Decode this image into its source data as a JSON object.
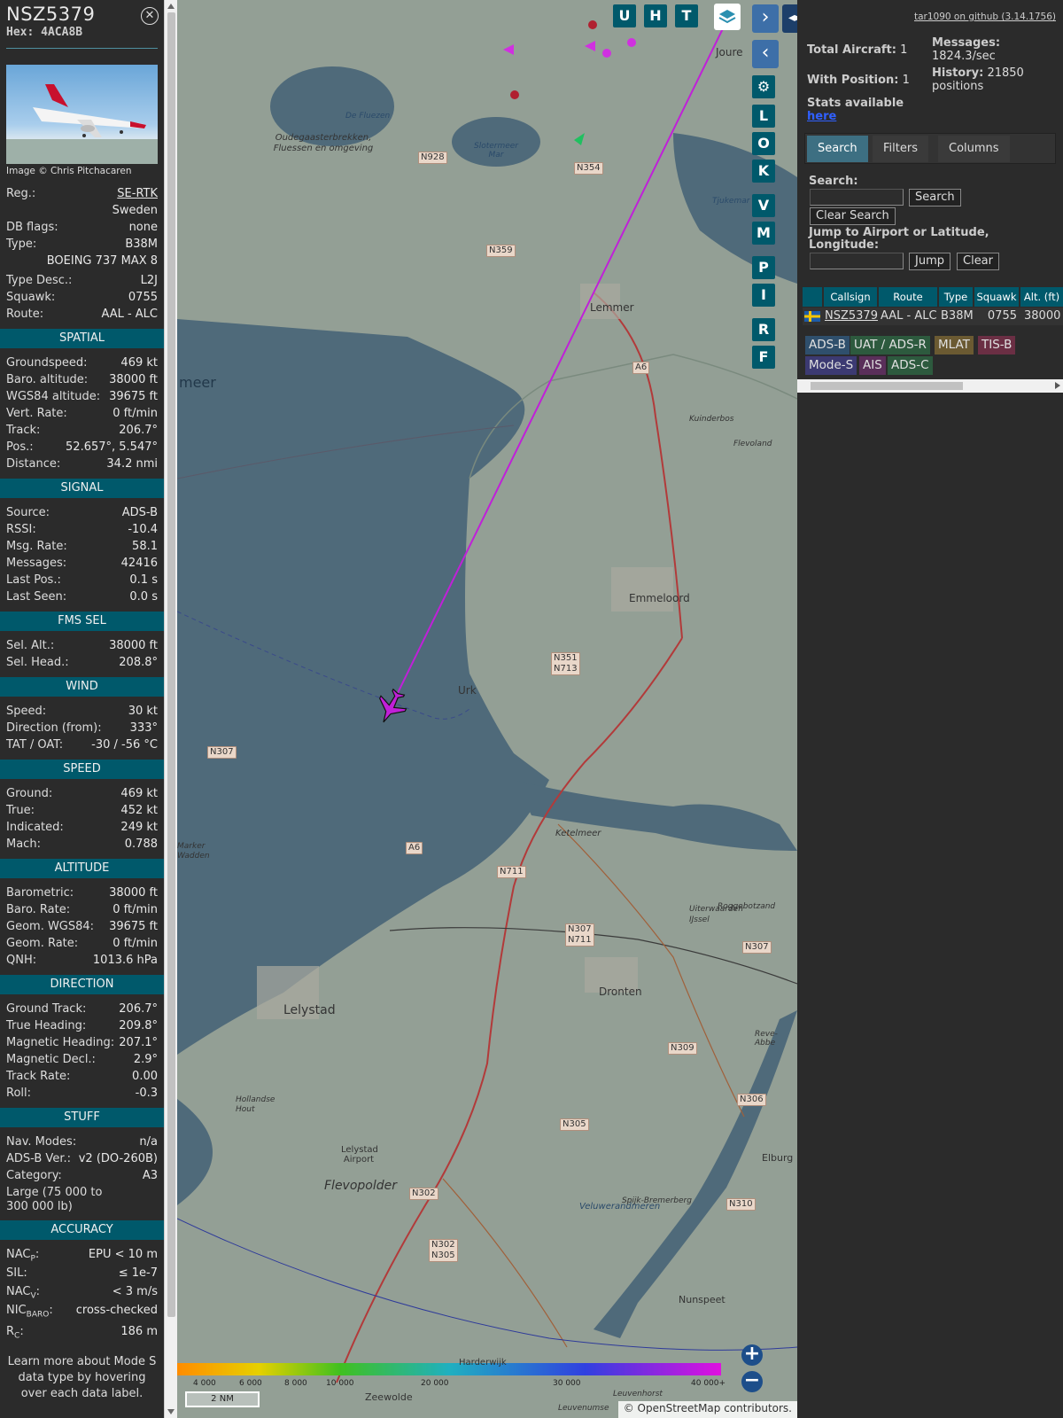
{
  "aircraft": {
    "callsign": "NSZ5379",
    "hex_label": "Hex: 4ACA8B",
    "image_credit": "Image © Chris Pitchacaren",
    "reg_label": "Reg.:",
    "reg": "SE-RTK",
    "country": "Sweden",
    "dbflags_label": "DB flags:",
    "dbflags": "none",
    "type_label": "Type:",
    "type": "B38M",
    "type_full": "BOEING 737 MAX 8",
    "typedesc_label": "Type Desc.:",
    "typedesc": "L2J",
    "squawk_label": "Squawk:",
    "squawk": "0755",
    "route_label": "Route:",
    "route": "AAL - ALC"
  },
  "sections": {
    "spatial": "SPATIAL",
    "signal": "SIGNAL",
    "fms": "FMS SEL",
    "wind": "WIND",
    "speed": "SPEED",
    "altitude": "ALTITUDE",
    "direction": "DIRECTION",
    "stuff": "STUFF",
    "accuracy": "ACCURACY"
  },
  "spatial": [
    {
      "label": "Groundspeed:",
      "value": "469 kt"
    },
    {
      "label": "Baro. altitude:",
      "value": "38000 ft"
    },
    {
      "label": "WGS84 altitude:",
      "value": "39675 ft"
    },
    {
      "label": "Vert. Rate:",
      "value": "0 ft/min"
    },
    {
      "label": "Track:",
      "value": "206.7°"
    },
    {
      "label": "Pos.:",
      "value": "52.657°, 5.547°"
    },
    {
      "label": "Distance:",
      "value": "34.2 nmi"
    }
  ],
  "signal": [
    {
      "label": "Source:",
      "value": "ADS-B"
    },
    {
      "label": "RSSI:",
      "value": "-10.4"
    },
    {
      "label": "Msg. Rate:",
      "value": "58.1"
    },
    {
      "label": "Messages:",
      "value": "42416"
    },
    {
      "label": "Last Pos.:",
      "value": "0.1 s"
    },
    {
      "label": "Last Seen:",
      "value": "0.0 s"
    }
  ],
  "fms": [
    {
      "label": "Sel. Alt.:",
      "value": "38000 ft"
    },
    {
      "label": "Sel. Head.:",
      "value": "208.8°"
    }
  ],
  "wind": [
    {
      "label": "Speed:",
      "value": "30 kt"
    },
    {
      "label": "Direction (from):",
      "value": "333°"
    },
    {
      "label": "TAT / OAT:",
      "value": "-30 / -56 °C"
    }
  ],
  "speed": [
    {
      "label": "Ground:",
      "value": "469 kt"
    },
    {
      "label": "True:",
      "value": "452 kt"
    },
    {
      "label": "Indicated:",
      "value": "249 kt"
    },
    {
      "label": "Mach:",
      "value": "0.788"
    }
  ],
  "altitude": [
    {
      "label": "Barometric:",
      "value": "38000 ft"
    },
    {
      "label": "Baro. Rate:",
      "value": "0 ft/min"
    },
    {
      "label": "Geom. WGS84:",
      "value": "39675 ft"
    },
    {
      "label": "Geom. Rate:",
      "value": "0 ft/min"
    },
    {
      "label": "QNH:",
      "value": "1013.6 hPa"
    }
  ],
  "direction": [
    {
      "label": "Ground Track:",
      "value": "206.7°"
    },
    {
      "label": "True Heading:",
      "value": "209.8°"
    },
    {
      "label": "Magnetic Heading:",
      "value": "207.1°"
    },
    {
      "label": "Magnetic Decl.:",
      "value": "2.9°"
    },
    {
      "label": "Track Rate:",
      "value": "0.00"
    },
    {
      "label": "Roll:",
      "value": "-0.3"
    }
  ],
  "stuff": {
    "navmodes_label": "Nav. Modes:",
    "navmodes": "n/a",
    "adsbver_label": "ADS-B Ver.:",
    "adsbver": "v2 (DO-260B)",
    "category_label": "Category:",
    "category": "A3",
    "category_desc": "Large (75 000 to 300 000 lb)"
  },
  "accuracy": {
    "nacp_label": "NAC",
    "nacp_sub": "P",
    "nacp": "EPU < 10 m",
    "sil_label": "SIL:",
    "sil": "≤ 1e-7",
    "nacv_label": "NAC",
    "nacv_sub": "V",
    "nacv": "< 3 m/s",
    "nicbaro_label": "NIC",
    "nicbaro_sub": "BARO",
    "nicbaro": "cross-checked",
    "rc_label": "R",
    "rc_sub": "C",
    "rc": "186 m"
  },
  "footer_note": "Learn more about Mode S data type by hovering over each data label.",
  "map": {
    "buttons": [
      "U",
      "H",
      "T"
    ],
    "side_buttons": [
      "L",
      "O",
      "K",
      "V",
      "M",
      "P",
      "I",
      "R",
      "F"
    ],
    "scale": "2 NM",
    "attribution": "© OpenStreetMap contributors.",
    "legend_ticks": [
      "4 000",
      "6 000",
      "8 000",
      "10 000",
      "20 000",
      "30 000",
      "40 000+"
    ],
    "places": [
      "Joure",
      "Lemmer",
      "Emmeloord",
      "Urk",
      "Lelystad",
      "Dronten",
      "Flevopolder",
      "Lelystad Airport",
      "Nunspeet",
      "Elburg",
      "Harderwijk",
      "Zeewolde",
      "Ketelmeer",
      "Veluwerandmeren",
      "De Fluezen",
      "Oudegaasterbrekken, Fluessen en omgeving",
      "Slotermeer Mar",
      "Tjukemar",
      "Kuinderbos",
      "Flevoland",
      "Uiterwaarden IJssel",
      "Roggebotzand",
      "Reve-Abbe",
      "Spijk-Bremerberg",
      "Hollandse Hout",
      "meer",
      "Marker Wadden",
      "Leuvenhorst",
      "Leuvenumse"
    ],
    "roads": [
      "N928",
      "N354",
      "N359",
      "A6",
      "N351",
      "N713",
      "N307",
      "N711",
      "N309",
      "N306",
      "N305",
      "N302",
      "N310"
    ]
  },
  "panel": {
    "github": "tar1090 on github (3.14.1756)",
    "total_label": "Total Aircraft:",
    "total": "1",
    "withpos_label": "With Position:",
    "withpos": "1",
    "stats_label": "Stats available",
    "stats_link": "here",
    "messages_label": "Messages:",
    "messages": "1824.3/sec",
    "history_label": "History:",
    "history": "21850 positions",
    "tabs": [
      "Search",
      "Filters",
      "Columns"
    ],
    "search_label": "Search:",
    "search_btn": "Search",
    "clear_search_btn": "Clear Search",
    "jump_label": "Jump to Airport or Latitude, Longitude:",
    "jump_btn": "Jump",
    "clear_btn": "Clear",
    "columns": [
      "",
      "Callsign",
      "Route",
      "Type",
      "Squawk",
      "Alt. (ft)"
    ],
    "row": {
      "callsign": "NSZ5379",
      "route": "AAL - ALC",
      "type": "B38M",
      "squawk": "0755",
      "alt": "38000"
    },
    "badges": [
      {
        "label": "ADS-B",
        "bg": "#2f4f6c",
        "fg": "#e0e0e0"
      },
      {
        "label": "UAT / ADS-R",
        "bg": "#2d5a3e",
        "fg": "#e0e0e0"
      },
      {
        "label": "MLAT",
        "bg": "#6b5a32",
        "fg": "#e0e0e0"
      },
      {
        "label": "TIS-B",
        "bg": "#6b2f44",
        "fg": "#e0e0e0"
      },
      {
        "label": "Mode-S",
        "bg": "#3c3a72",
        "fg": "#e0e0e0"
      },
      {
        "label": "AIS",
        "bg": "#5a2f5a",
        "fg": "#e0e0e0"
      },
      {
        "label": "ADS-C",
        "bg": "#2d5a3e",
        "fg": "#e0e0e0"
      }
    ]
  },
  "colors": {
    "accent": "#00596b",
    "track": "#c020d8",
    "tab_active": "#3d6f82"
  }
}
